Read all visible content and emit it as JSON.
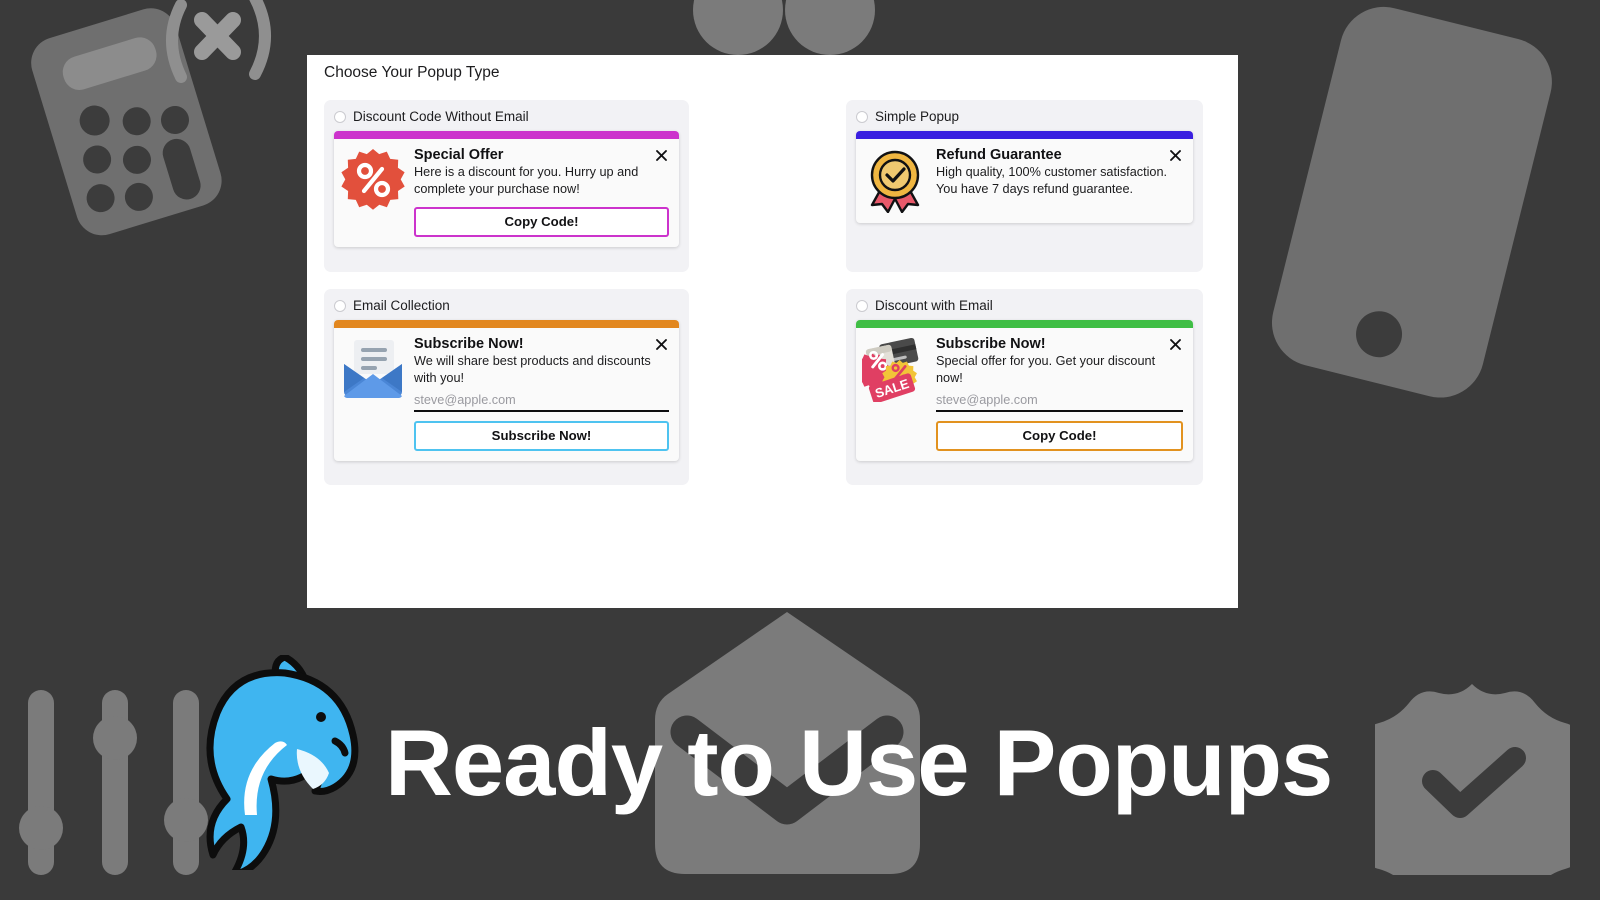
{
  "banner": {
    "title": "Ready to Use Popups",
    "decorations": [
      "calculator-icon",
      "formula-x-icon",
      "smartphone-icon",
      "circles-icon",
      "sliders-icon",
      "dolphin-mascot-icon",
      "envelope-icon",
      "verified-badge-icon"
    ]
  },
  "panel": {
    "title": "Choose Your Popup Type",
    "options": [
      {
        "id": "discount-code-without-email",
        "label": "Discount Code Without Email",
        "selected": false,
        "accent": "#CC33CC",
        "icon": "percent-badge-icon",
        "popup": {
          "title": "Special Offer",
          "description": "Here is a discount for you. Hurry up and complete your purchase now!",
          "close_label": "✕",
          "has_email": false,
          "email_placeholder": "",
          "button_label": "Copy Code!",
          "button_border": "#CC33CC"
        }
      },
      {
        "id": "simple-popup",
        "label": "Simple Popup",
        "selected": false,
        "accent": "#3A1FE0",
        "icon": "award-medal-icon",
        "popup": {
          "title": "Refund Guarantee",
          "description": "High quality, 100% customer satisfaction. You have 7 days refund guarantee.",
          "close_label": "✕",
          "has_email": false,
          "email_placeholder": "",
          "button_label": "",
          "button_border": ""
        }
      },
      {
        "id": "email-collection",
        "label": "Email Collection",
        "selected": false,
        "accent": "#E2871F",
        "icon": "open-envelope-icon",
        "popup": {
          "title": "Subscribe Now!",
          "description": "We will share best products and discounts with you!",
          "close_label": "✕",
          "has_email": true,
          "email_placeholder": "steve@apple.com",
          "button_label": "Subscribe Now!",
          "button_border": "#4EC3F0"
        }
      },
      {
        "id": "discount-with-email",
        "label": "Discount with Email",
        "selected": false,
        "accent": "#3FBE45",
        "icon": "sale-tag-icon",
        "popup": {
          "title": "Subscribe Now!",
          "description": "Special offer for you. Get your discount now!",
          "close_label": "✕",
          "has_email": true,
          "email_placeholder": "steve@apple.com",
          "button_label": "Copy Code!",
          "button_border": "#E2921F"
        }
      }
    ]
  },
  "colors": {
    "background": "#3a3a3a",
    "panel": "#ffffff",
    "card": "#f2f2f5",
    "popup": "#fafafa",
    "deco": "#7b7b7b",
    "dolphin": "#3FB5F0"
  }
}
